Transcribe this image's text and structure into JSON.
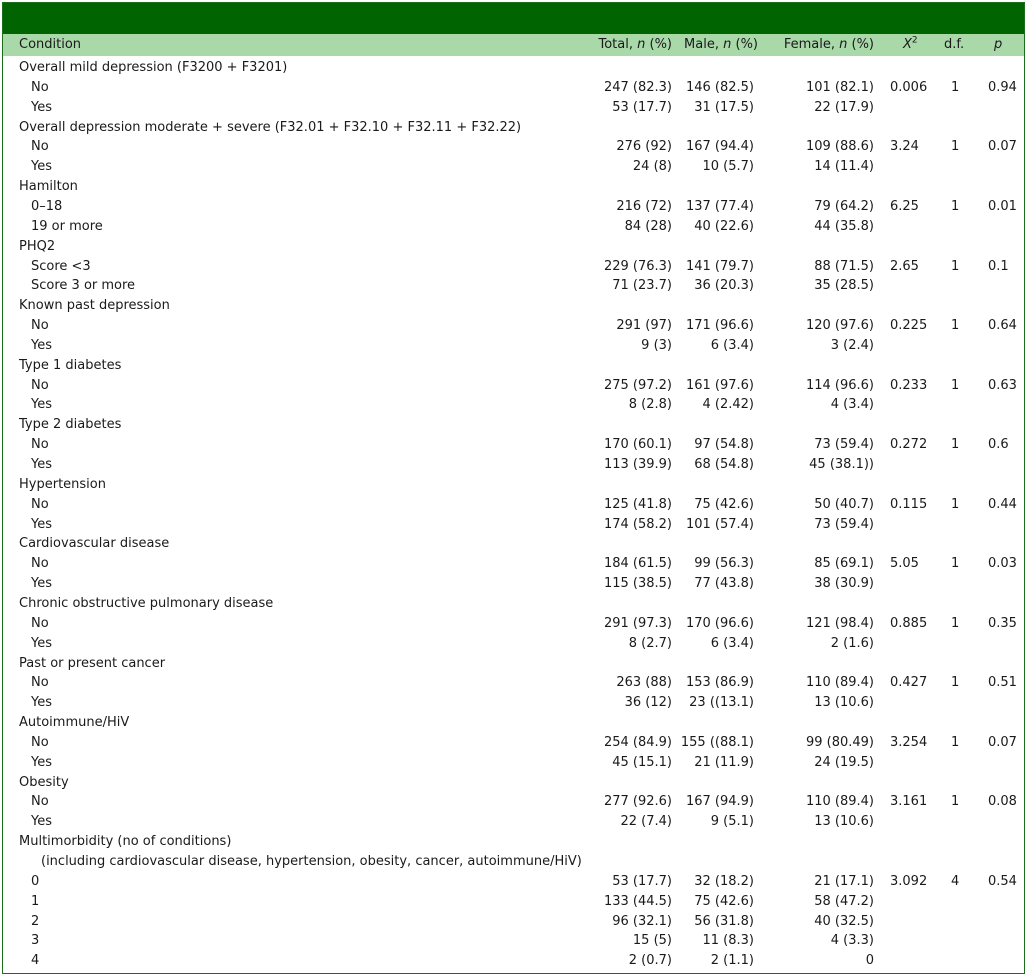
{
  "header": {
    "condition": "Condition",
    "total_pre": "Total, ",
    "male_pre": "Male, ",
    "female_pre": "Female, ",
    "n_italic": "n",
    "pct": " (%)",
    "chi": "X",
    "chi_sup": "2",
    "df": "d.f.",
    "p": "p"
  },
  "rows": [
    {
      "label": "Overall mild depression (F3200 + F3201)",
      "indent": 0
    },
    {
      "label": "No",
      "indent": 1,
      "total": "247 (82.3)",
      "male": "146 (82.5)",
      "female": "101 (82.1)",
      "chi": "0.006",
      "df": "1",
      "p": "0.94"
    },
    {
      "label": "Yes",
      "indent": 1,
      "total": "53 (17.7)",
      "male": "31 (17.5)",
      "female": "22 (17.9)"
    },
    {
      "label": "Overall depression moderate + severe (F32.01 + F32.10 + F32.11 + F32.22)",
      "indent": 0
    },
    {
      "label": "No",
      "indent": 1,
      "total": "276 (92)",
      "male": "167 (94.4)",
      "female": "109 (88.6)",
      "chi": "3.24",
      "df": "1",
      "p": "0.07"
    },
    {
      "label": "Yes",
      "indent": 1,
      "total": "24 (8)",
      "male": "10 (5.7)",
      "female": "14 (11.4)"
    },
    {
      "label": "Hamilton",
      "indent": 0
    },
    {
      "label": "0–18",
      "indent": 1,
      "total": "216 (72)",
      "male": "137 (77.4)",
      "female": "79 (64.2)",
      "chi": "6.25",
      "df": "1",
      "p": "0.01"
    },
    {
      "label": "19 or more",
      "indent": 1,
      "total": "84 (28)",
      "male": "40 (22.6)",
      "female": "44 (35.8)"
    },
    {
      "label": "PHQ2",
      "indent": 0
    },
    {
      "label": "Score <3",
      "indent": 1,
      "total": "229 (76.3)",
      "male": "141 (79.7)",
      "female": "88 (71.5)",
      "chi": "2.65",
      "df": "1",
      "p": "0.1"
    },
    {
      "label": "Score 3 or more",
      "indent": 1,
      "total": "71 (23.7)",
      "male": "36 (20.3)",
      "female": "35 (28.5)"
    },
    {
      "label": "Known past depression",
      "indent": 0
    },
    {
      "label": "No",
      "indent": 1,
      "total": "291 (97)",
      "male": "171 (96.6)",
      "female": "120 (97.6)",
      "chi": "0.225",
      "df": "1",
      "p": "0.64"
    },
    {
      "label": "Yes",
      "indent": 1,
      "total": "9 (3)",
      "male": "6 (3.4)",
      "female": "3 (2.4)"
    },
    {
      "label": "Type 1 diabetes",
      "indent": 0
    },
    {
      "label": "No",
      "indent": 1,
      "total": "275 (97.2)",
      "male": "161 (97.6)",
      "female": "114 (96.6)",
      "chi": "0.233",
      "df": "1",
      "p": "0.63"
    },
    {
      "label": "Yes",
      "indent": 1,
      "total": "8 (2.8)",
      "male": "4 (2.42)",
      "female": "4 (3.4)"
    },
    {
      "label": "Type 2 diabetes",
      "indent": 0
    },
    {
      "label": "No",
      "indent": 1,
      "total": "170 (60.1)",
      "male": "97 (54.8)",
      "female": "73 (59.4)",
      "chi": "0.272",
      "df": "1",
      "p": "0.6"
    },
    {
      "label": "Yes",
      "indent": 1,
      "total": "113 (39.9)",
      "male": "68 (54.8)",
      "female": "45 (38.1))"
    },
    {
      "label": "Hypertension",
      "indent": 0
    },
    {
      "label": "No",
      "indent": 1,
      "total": "125 (41.8)",
      "male": "75 (42.6)",
      "female": "50 (40.7)",
      "chi": "0.115",
      "df": "1",
      "p": "0.44"
    },
    {
      "label": "Yes",
      "indent": 1,
      "total": "174 (58.2)",
      "male": "101 (57.4)",
      "female": "73 (59.4)"
    },
    {
      "label": "Cardiovascular disease",
      "indent": 0
    },
    {
      "label": "No",
      "indent": 1,
      "total": "184 (61.5)",
      "male": "99 (56.3)",
      "female": "85 (69.1)",
      "chi": "5.05",
      "df": "1",
      "p": "0.03"
    },
    {
      "label": "Yes",
      "indent": 1,
      "total": "115 (38.5)",
      "male": "77 (43.8)",
      "female": "38 (30.9)"
    },
    {
      "label": "Chronic obstructive pulmonary disease",
      "indent": 0
    },
    {
      "label": "No",
      "indent": 1,
      "total": "291 (97.3)",
      "male": "170 (96.6)",
      "female": "121 (98.4)",
      "chi": "0.885",
      "df": "1",
      "p": "0.35"
    },
    {
      "label": "Yes",
      "indent": 1,
      "total": "8 (2.7)",
      "male": "6 (3.4)",
      "female": "2 (1.6)"
    },
    {
      "label": "Past or present cancer",
      "indent": 0
    },
    {
      "label": "No",
      "indent": 1,
      "total": "263 (88)",
      "male": "153 (86.9)",
      "female": "110 (89.4)",
      "chi": "0.427",
      "df": "1",
      "p": "0.51"
    },
    {
      "label": "Yes",
      "indent": 1,
      "total": "36 (12)",
      "male": "23 ((13.1)",
      "female": "13 (10.6)"
    },
    {
      "label": "Autoimmune/HiV",
      "indent": 0
    },
    {
      "label": "No",
      "indent": 1,
      "total": "254 (84.9)",
      "male": "155 ((88.1)",
      "female": "99 (80.49)",
      "chi": "3.254",
      "df": "1",
      "p": "0.07"
    },
    {
      "label": "Yes",
      "indent": 1,
      "total": "45 (15.1)",
      "male": "21 (11.9)",
      "female": "24 (19.5)"
    },
    {
      "label": "Obesity",
      "indent": 0
    },
    {
      "label": "No",
      "indent": 1,
      "total": "277 (92.6)",
      "male": "167 (94.9)",
      "female": "110 (89.4)",
      "chi": "3.161",
      "df": "1",
      "p": "0.08"
    },
    {
      "label": "Yes",
      "indent": 1,
      "total": "22 (7.4)",
      "male": "9 (5.1)",
      "female": "13 (10.6)"
    },
    {
      "label": "Multimorbidity (no of conditions)",
      "indent": 0
    },
    {
      "label": "(including cardiovascular disease, hypertension, obesity, cancer, autoimmune/HiV)",
      "indent": 2
    },
    {
      "label": "0",
      "indent": 1,
      "total": "53 (17.7)",
      "male": "32 (18.2)",
      "female": "21 (17.1)",
      "chi": "3.092",
      "df": "4",
      "p": "0.54"
    },
    {
      "label": "1",
      "indent": 1,
      "total": "133 (44.5)",
      "male": "75 (42.6)",
      "female": "58 (47.2)"
    },
    {
      "label": "2",
      "indent": 1,
      "total": "96 (32.1)",
      "male": "56 (31.8)",
      "female": "40 (32.5)"
    },
    {
      "label": "3",
      "indent": 1,
      "total": "15 (5)",
      "male": "11 (8.3)",
      "female": "4 (3.3)"
    },
    {
      "label": "4",
      "indent": 1,
      "total": "2 (0.7)",
      "male": "2 (1.1)",
      "female": "0"
    }
  ]
}
